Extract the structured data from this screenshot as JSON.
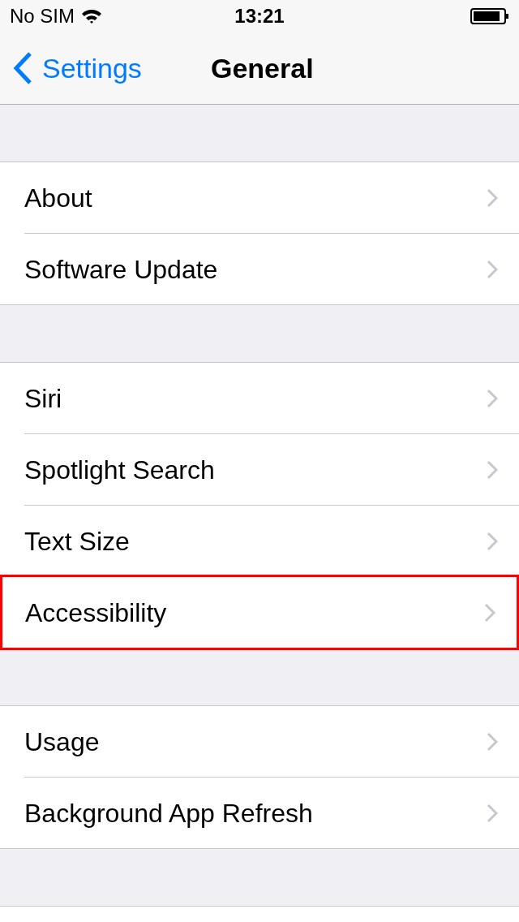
{
  "status_bar": {
    "carrier": "No SIM",
    "time": "13:21"
  },
  "nav": {
    "back": "Settings",
    "title": "General"
  },
  "groups": [
    {
      "items": [
        {
          "label": "About",
          "highlighted": false
        },
        {
          "label": "Software Update",
          "highlighted": false
        }
      ]
    },
    {
      "items": [
        {
          "label": "Siri",
          "highlighted": false
        },
        {
          "label": "Spotlight Search",
          "highlighted": false
        },
        {
          "label": "Text Size",
          "highlighted": false
        },
        {
          "label": "Accessibility",
          "highlighted": true
        }
      ]
    },
    {
      "items": [
        {
          "label": "Usage",
          "highlighted": false
        },
        {
          "label": "Background App Refresh",
          "highlighted": false
        }
      ]
    }
  ]
}
